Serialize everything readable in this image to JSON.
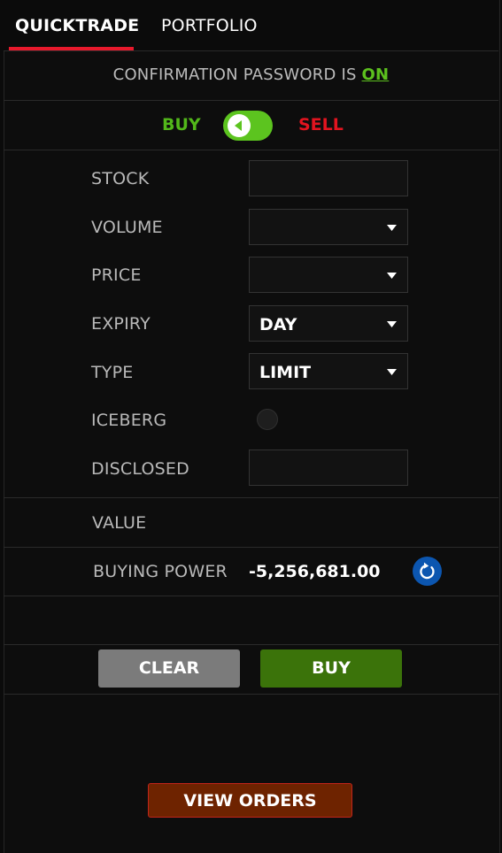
{
  "tabs": [
    {
      "label": "QUICKTRADE",
      "active": true
    },
    {
      "label": "PORTFOLIO",
      "active": false
    }
  ],
  "confirmation": {
    "prefix": "CONFIRMATION PASSWORD IS ",
    "status": "ON"
  },
  "side_toggle": {
    "buy_label": "BUY",
    "sell_label": "SELL",
    "selected": "BUY"
  },
  "form": {
    "stock": {
      "label": "STOCK",
      "value": ""
    },
    "volume": {
      "label": "VOLUME",
      "value": ""
    },
    "price": {
      "label": "PRICE",
      "value": ""
    },
    "expiry": {
      "label": "EXPIRY",
      "value": "DAY"
    },
    "type": {
      "label": "TYPE",
      "value": "LIMIT"
    },
    "iceberg": {
      "label": "ICEBERG",
      "checked": false
    },
    "disclosed": {
      "label": "DISCLOSED",
      "value": ""
    },
    "value": {
      "label": "VALUE",
      "value": ""
    },
    "buying_power": {
      "label": "BUYING POWER",
      "value": "-5,256,681.00"
    }
  },
  "buttons": {
    "clear": "CLEAR",
    "buy": "BUY",
    "view_orders": "VIEW ORDERS"
  },
  "colors": {
    "accent_red": "#e8192c",
    "buy_green": "#52b71a",
    "sell_red": "#e2141f",
    "buy_button": "#3b730a",
    "clear_button": "#7b7b7b",
    "view_orders_button": "#6e2300",
    "refresh_blue": "#0c56b0"
  },
  "icons": {
    "toggle_knob": "chevron-left-icon",
    "dropdown": "caret-down-icon",
    "refresh": "refresh-icon"
  }
}
